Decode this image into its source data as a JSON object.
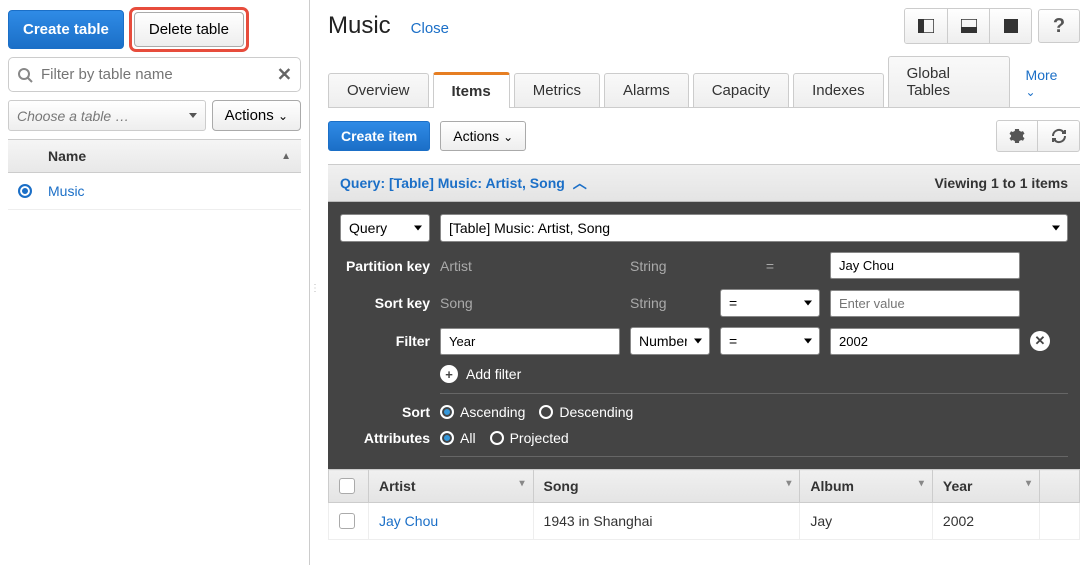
{
  "sidebar": {
    "create_label": "Create table",
    "delete_label": "Delete table",
    "filter_placeholder": "Filter by table name",
    "choose_label": "Choose a table …",
    "actions_label": "Actions",
    "name_header": "Name",
    "tables": [
      {
        "name": "Music",
        "selected": true
      }
    ]
  },
  "header": {
    "title": "Music",
    "close_label": "Close"
  },
  "tabs": {
    "items": [
      {
        "label": "Overview"
      },
      {
        "label": "Items",
        "active": true
      },
      {
        "label": "Metrics"
      },
      {
        "label": "Alarms"
      },
      {
        "label": "Capacity"
      },
      {
        "label": "Indexes"
      },
      {
        "label": "Global Tables"
      }
    ],
    "more_label": "More"
  },
  "item_bar": {
    "create_item_label": "Create item",
    "actions_label": "Actions"
  },
  "query_header": {
    "label": "Query: [Table] Music: Artist, Song",
    "viewing": "Viewing 1 to 1 items"
  },
  "query_panel": {
    "mode": "Query",
    "target": "[Table] Music: Artist, Song",
    "partition_key_label": "Partition key",
    "partition_key_name": "Artist",
    "partition_key_type": "String",
    "partition_key_op": "=",
    "partition_key_value": "Jay Chou",
    "sort_key_label": "Sort key",
    "sort_key_name": "Song",
    "sort_key_type": "String",
    "sort_key_op": "=",
    "sort_key_placeholder": "Enter value",
    "filter_label": "Filter",
    "filter_attr": "Year",
    "filter_type": "Number",
    "filter_op": "=",
    "filter_value": "2002",
    "add_filter_label": "Add filter",
    "sort_label": "Sort",
    "sort_asc": "Ascending",
    "sort_desc": "Descending",
    "attributes_label": "Attributes",
    "attr_all": "All",
    "attr_projected": "Projected"
  },
  "results": {
    "columns": [
      "Artist",
      "Song",
      "Album",
      "Year"
    ],
    "rows": [
      {
        "artist": "Jay Chou",
        "song": "1943 in Shanghai",
        "album": "Jay",
        "year": "2002"
      }
    ]
  }
}
